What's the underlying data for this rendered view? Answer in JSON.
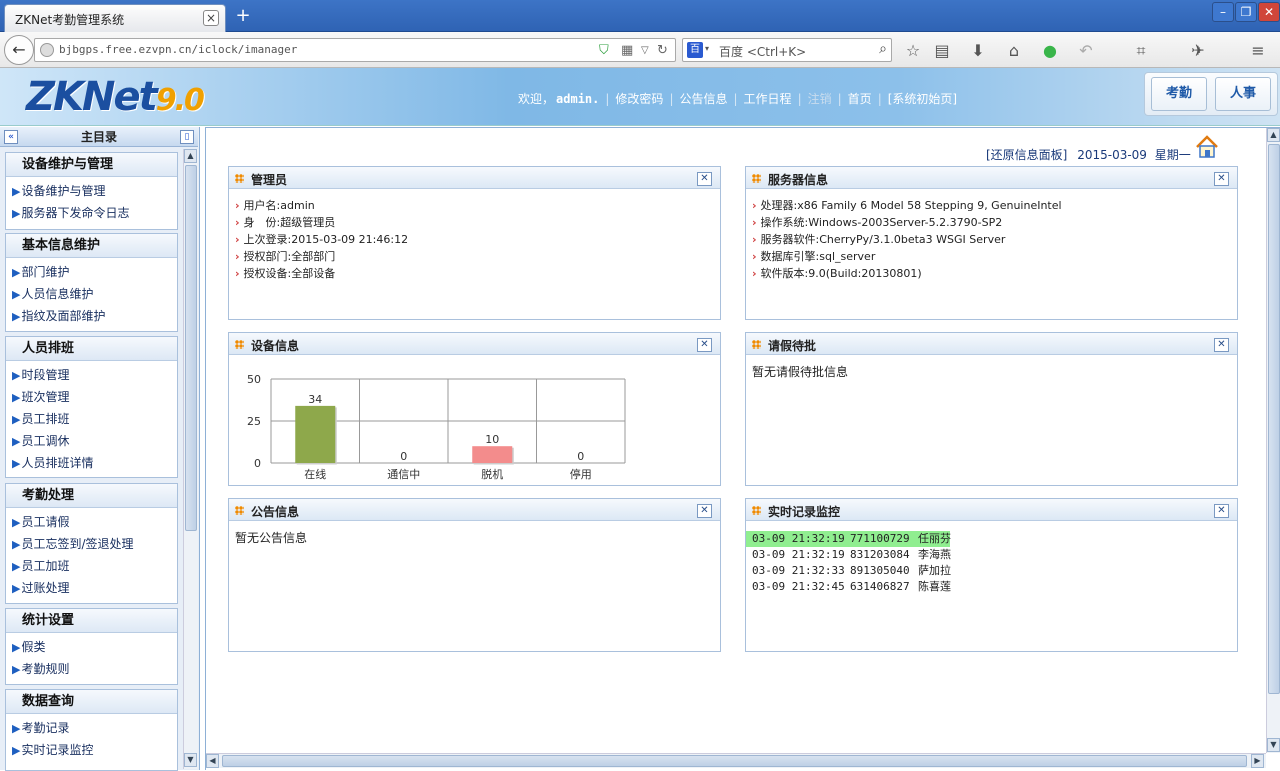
{
  "browser": {
    "tab_title": "ZKNet考勤管理系统",
    "tab_close": "×",
    "new_tab": "+",
    "url": "bjbgps.free.ezvpn.cn/iclock/imanager",
    "search_engine": "百度",
    "search_placeholder": "百度 <Ctrl+K>"
  },
  "header": {
    "logo_text": "ZKNet",
    "logo_version": "9.0",
    "welcome": "欢迎，",
    "username": "admin.",
    "links": [
      "修改密码",
      "公告信息",
      "工作日程",
      "注销",
      "首页",
      "[系统初始页]"
    ],
    "modules": [
      "考勤",
      "人事"
    ]
  },
  "sidebar": {
    "title": "主目录",
    "collapse_btn": "«",
    "pin_btn": "▯",
    "groups": [
      {
        "title": "设备维护与管理",
        "items": [
          "设备维护与管理",
          "服务器下发命令日志"
        ]
      },
      {
        "title": "基本信息维护",
        "items": [
          "部门维护",
          "人员信息维护",
          "指纹及面部维护"
        ]
      },
      {
        "title": "人员排班",
        "items": [
          "时段管理",
          "班次管理",
          "员工排班",
          "员工调休",
          "人员排班详情"
        ]
      },
      {
        "title": "考勤处理",
        "items": [
          "员工请假",
          "员工忘签到/签退处理",
          "员工加班",
          "过账处理"
        ]
      },
      {
        "title": "统计设置",
        "items": [
          "假类",
          "考勤规则"
        ]
      },
      {
        "title": "数据查询",
        "items": [
          "考勤记录",
          "实时记录监控"
        ]
      }
    ]
  },
  "main": {
    "restore_link": "[还原信息面板]",
    "date": "2015-03-09",
    "weekday": "星期一",
    "panels": {
      "admin": {
        "title": "管理员",
        "lines": [
          "用户名:admin",
          "身　份:超级管理员",
          "上次登录:2015-03-09 21:46:12",
          "授权部门:全部部门",
          "授权设备:全部设备"
        ]
      },
      "server": {
        "title": "服务器信息",
        "lines": [
          "处理器:x86 Family 6 Model 58 Stepping 9, GenuineIntel",
          "操作系统:Windows-2003Server-5.2.3790-SP2",
          "服务器软件:CherryPy/3.1.0beta3 WSGI Server",
          "数据库引擎:sql_server",
          "软件版本:9.0(Build:20130801)"
        ]
      },
      "device": {
        "title": "设备信息"
      },
      "leave": {
        "title": "请假待批",
        "text": "暂无请假待批信息"
      },
      "notice": {
        "title": "公告信息",
        "text": "暂无公告信息"
      },
      "monitor": {
        "title": "实时记录监控",
        "records": [
          {
            "time": "03-09 21:32:19",
            "id": "771100729",
            "name": "任丽芬",
            "highlight": true
          },
          {
            "time": "03-09 21:32:19",
            "id": "831203084",
            "name": "李海燕",
            "highlight": false
          },
          {
            "time": "03-09 21:32:33",
            "id": "891305040",
            "name": "萨加拉",
            "highlight": false
          },
          {
            "time": "03-09 21:32:45",
            "id": "631406827",
            "name": "陈喜莲",
            "highlight": false
          }
        ]
      }
    }
  },
  "chart_data": {
    "type": "bar",
    "categories": [
      "在线",
      "通信中",
      "脱机",
      "停用"
    ],
    "values": [
      34,
      0,
      10,
      0
    ],
    "colors": [
      "#8ea84b",
      "#8ea84b",
      "#f38c8c",
      "#8ea84b"
    ],
    "ylim": [
      0,
      50
    ],
    "yticks": [
      0,
      25,
      50
    ]
  }
}
